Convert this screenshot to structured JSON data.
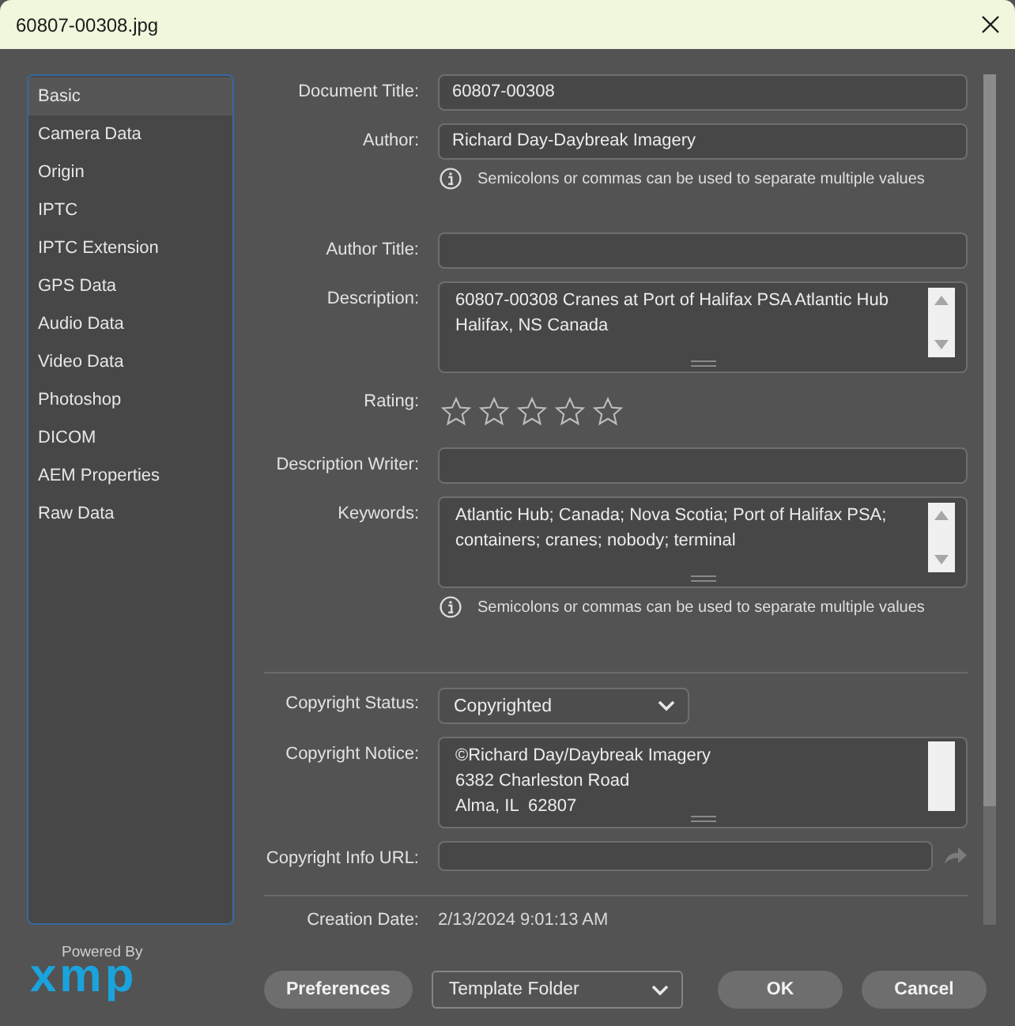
{
  "window": {
    "title": "60807-00308.jpg"
  },
  "sidebar": {
    "items": [
      {
        "label": "Basic",
        "selected": true
      },
      {
        "label": "Camera Data",
        "selected": false
      },
      {
        "label": "Origin",
        "selected": false
      },
      {
        "label": "IPTC",
        "selected": false
      },
      {
        "label": "IPTC Extension",
        "selected": false
      },
      {
        "label": "GPS Data",
        "selected": false
      },
      {
        "label": "Audio Data",
        "selected": false
      },
      {
        "label": "Video Data",
        "selected": false
      },
      {
        "label": "Photoshop",
        "selected": false
      },
      {
        "label": "DICOM",
        "selected": false
      },
      {
        "label": "AEM Properties",
        "selected": false
      },
      {
        "label": "Raw Data",
        "selected": false
      }
    ]
  },
  "branding": {
    "caption": "Powered By",
    "logo": "xmp"
  },
  "form": {
    "fields": [
      {
        "kind": "text",
        "label": "Document Title:",
        "value": "60807-00308"
      },
      {
        "kind": "text",
        "label": "Author:",
        "value": "Richard Day-Daybreak Imagery"
      },
      {
        "kind": "hint",
        "text": "Semicolons or commas can be used to separate multiple values"
      },
      {
        "kind": "text",
        "label": "Author Title:"
      },
      {
        "kind": "textarea",
        "label": "Description:",
        "value": "60807-00308 Cranes at Port of Halifax PSA Atlantic Hub\nHalifax, NS Canada",
        "scroll_arrows": true
      },
      {
        "kind": "rating",
        "label": "Rating:",
        "stars": 0
      },
      {
        "kind": "text",
        "label": "Description Writer:"
      },
      {
        "kind": "textarea",
        "label": "Keywords:",
        "value": "Atlantic Hub; Canada; Nova Scotia; Port of Halifax PSA;\ncontainers; cranes; nobody; terminal",
        "scroll_arrows": true
      },
      {
        "kind": "hint",
        "text": "Semicolons or commas can be used to separate multiple values"
      },
      {
        "kind": "divider"
      },
      {
        "kind": "dropdown",
        "label": "Copyright Status:",
        "value": "Copyrighted"
      },
      {
        "kind": "textarea",
        "label": "Copyright Notice:",
        "value": "©Richard Day/Daybreak Imagery\n6382 Charleston Road\nAlma, IL  62807",
        "scroll_arrows": false
      },
      {
        "kind": "url",
        "label": "Copyright Info URL:"
      },
      {
        "kind": "divider"
      },
      {
        "kind": "readonly",
        "label": "Creation Date:",
        "value": "2/13/2024 9:01:13 AM"
      }
    ]
  },
  "footer": {
    "controls": [
      {
        "kind": "button",
        "label": "Preferences"
      },
      {
        "kind": "dropdown",
        "label": "Template Folder"
      },
      {
        "kind": "button",
        "label": "OK"
      },
      {
        "kind": "button",
        "label": "Cancel"
      }
    ]
  }
}
